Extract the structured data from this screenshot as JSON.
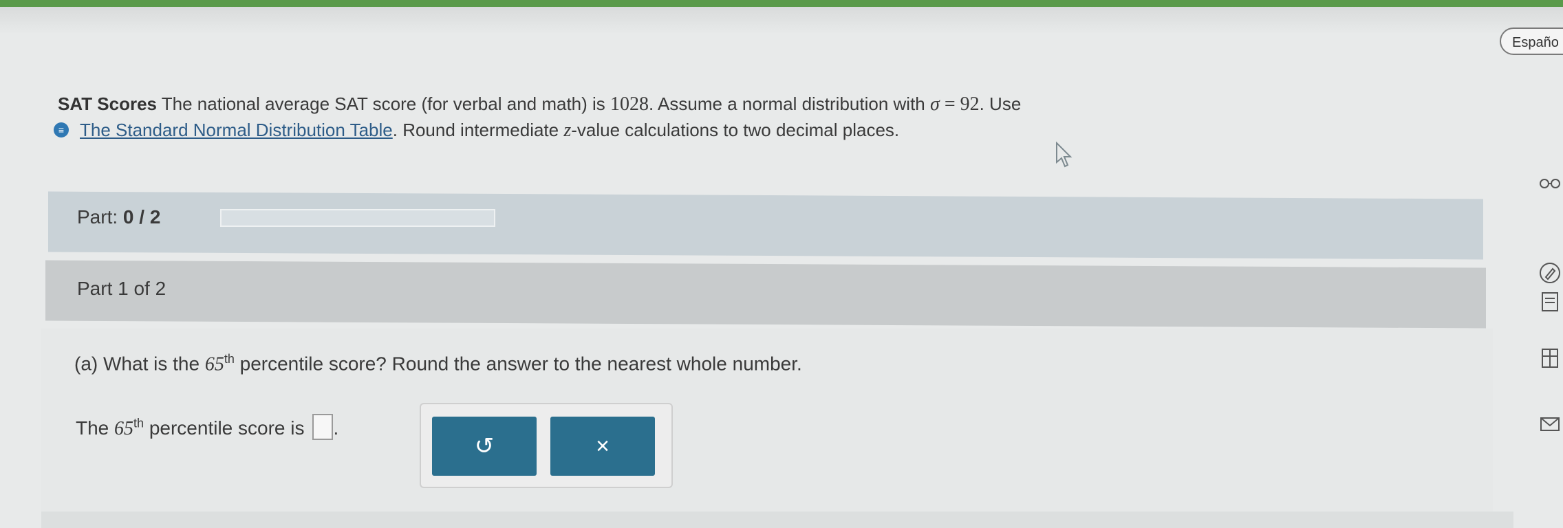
{
  "language_button": {
    "label": "Españo"
  },
  "problem": {
    "title": "SAT Scores",
    "text_a": " The national average SAT score (for verbal and math) is ",
    "mean": "1028",
    "text_b": ". Assume a normal distribution with ",
    "sigma_symbol": "σ",
    "equals": " = ",
    "sigma_value": "92",
    "text_c": ". Use",
    "table_icon": "≡",
    "table_link": "The Standard Normal Distribution Table",
    "text_d": ". Round intermediate ",
    "z_var": "z",
    "text_e": "-value calculations to two decimal places."
  },
  "part_progress": {
    "label": "Part: ",
    "current": "0",
    "separator": " / ",
    "total": "2",
    "progress_fraction": 0
  },
  "subpart": {
    "label": "Part 1 of 2"
  },
  "question": {
    "prefix": "(a) What is the ",
    "number": "65",
    "suffix_sup": "th",
    "rest": " percentile score? Round the answer to the nearest whole number."
  },
  "answer": {
    "prefix": "The ",
    "number": "65",
    "suffix_sup": "th",
    "rest": " percentile score is",
    "period": "."
  },
  "tools": {
    "undo_symbol": "↺",
    "clear_symbol": "×"
  },
  "side_icons": [
    "glasses-icon",
    "pencil-icon",
    "document-icon",
    "book-icon",
    "mail-icon"
  ],
  "colors": {
    "top_bar": "#5a9a4a",
    "tool_button": "#2b6f8e",
    "link": "#2d5c88",
    "progress_bar_bg": "#c9d2d7"
  }
}
